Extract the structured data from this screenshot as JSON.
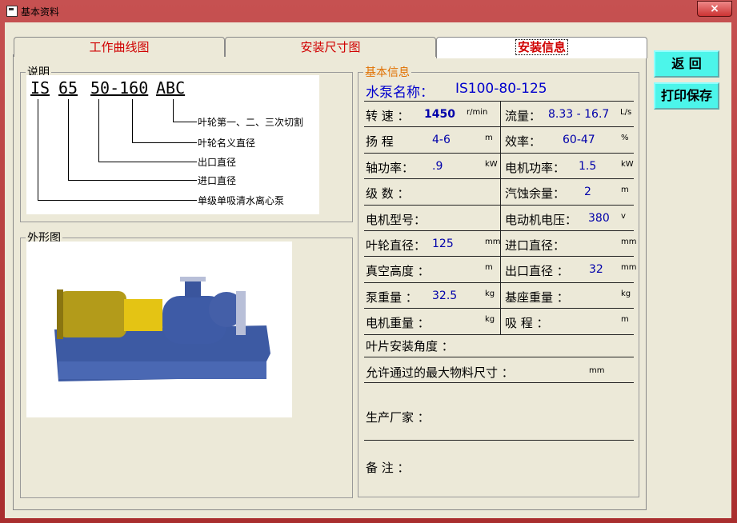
{
  "window": {
    "title": "基本资料",
    "close_label": "×"
  },
  "tabs": [
    {
      "label": "工作曲线图"
    },
    {
      "label": "安装尺寸图"
    },
    {
      "label": "安装信息"
    }
  ],
  "left": {
    "note_legend": "说明",
    "model_parts": [
      "IS",
      "65",
      "50-160",
      "ABC"
    ],
    "annotations": [
      "叶轮第一、二、三次切割",
      "叶轮名义直径",
      "出口直径",
      "进口直径",
      "单级单吸清水离心泵"
    ],
    "figure_legend": "外形图"
  },
  "info": {
    "legend": "基本信息",
    "pump_name_label": "水泵名称：",
    "pump_name": "IS100-80-125",
    "rows": [
      {
        "l_label": "转 速 ：",
        "l_val": "1450",
        "l_unit": "r/min",
        "r_label": "流量：",
        "r_val": "8.33 - 16.7",
        "r_unit": "L/s"
      },
      {
        "l_label": "扬 程",
        "l_val": "4-6",
        "l_unit": "m",
        "r_label": "效率：",
        "r_val": "60-47",
        "r_unit": "%"
      },
      {
        "l_label": "轴功率：",
        "l_val": ".9",
        "l_unit": "kW",
        "r_label": "电机功率：",
        "r_val": "1.5",
        "r_unit": "kW"
      },
      {
        "l_label": "级 数 ：",
        "l_val": "",
        "l_unit": "",
        "r_label": "汽蚀余量：",
        "r_val": "2",
        "r_unit": "m"
      },
      {
        "l_label": "电机型号：",
        "l_val": "",
        "l_unit": "",
        "r_label": "电动机电压：",
        "r_val": "380",
        "r_unit": "v"
      },
      {
        "l_label": "叶轮直径：",
        "l_val": "125",
        "l_unit": "mm",
        "r_label": "进口直径：",
        "r_val": "",
        "r_unit": "mm"
      },
      {
        "l_label": "真空高度 ：",
        "l_val": "",
        "l_unit": "m",
        "r_label": "出口直径 ：",
        "r_val": "32",
        "r_unit": "mm"
      },
      {
        "l_label": "泵重量 ：",
        "l_val": "32.5",
        "l_unit": "kg",
        "r_label": "基座重量 ：",
        "r_val": "",
        "r_unit": "kg"
      },
      {
        "l_label": "电机重量 ：",
        "l_val": "",
        "l_unit": "kg",
        "r_label": "吸 程 ：",
        "r_val": "",
        "r_unit": "m"
      }
    ],
    "blade_angle_label": "叶片安装角度 ：",
    "max_size_label": "允许通过的最大物料尺寸 ：",
    "max_size_unit": "mm",
    "manufacturer_label": "生产厂家 ：",
    "remark_label": "备  注 ："
  },
  "buttons": {
    "back": "返 回",
    "print_save": "打印保存"
  }
}
